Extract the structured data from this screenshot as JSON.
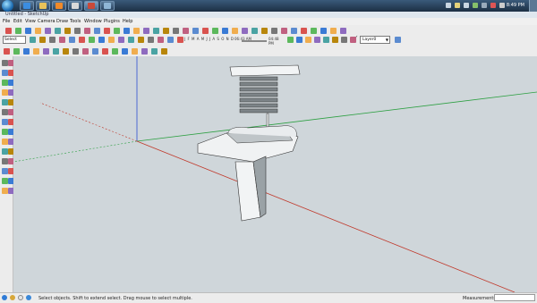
{
  "titlebar": {
    "text": "Untitled - SketchUp"
  },
  "taskbar": {
    "clock": "8:49 PM",
    "apps": [
      {
        "icon": "ie-icon",
        "color": "#3b8de0"
      },
      {
        "icon": "folder-icon",
        "color": "#e8c25a"
      },
      {
        "icon": "media-player-icon",
        "color": "#f08a2a"
      },
      {
        "icon": "app-icon",
        "color": "#d9d9d9"
      },
      {
        "icon": "sketchup-icon",
        "color": "#c94a3a"
      },
      {
        "icon": "window-icon",
        "color": "#8fb6d6"
      }
    ]
  },
  "menu": [
    "File",
    "Edit",
    "View",
    "Camera",
    "Draw",
    "Tools",
    "Window",
    "Plugins",
    "Help"
  ],
  "toolbar": {
    "select_label": "Select",
    "shadow_months": "J F M A M J J A S O N D",
    "shadow_time_start": "06:43 AM",
    "shadow_time_end": "04:48 PM",
    "layer_name": "Layer0",
    "layer_check": "✓"
  },
  "statusbar": {
    "text": "Select objects. Shift to extend select. Drag mouse to select multiple.",
    "measurements_label": "Measurements",
    "measurements_value": ""
  },
  "colors": {
    "axis_red": "#c0392b",
    "axis_green": "#2ea043",
    "axis_blue": "#2b4ecf",
    "viewport_bg": "#cfd6da"
  }
}
